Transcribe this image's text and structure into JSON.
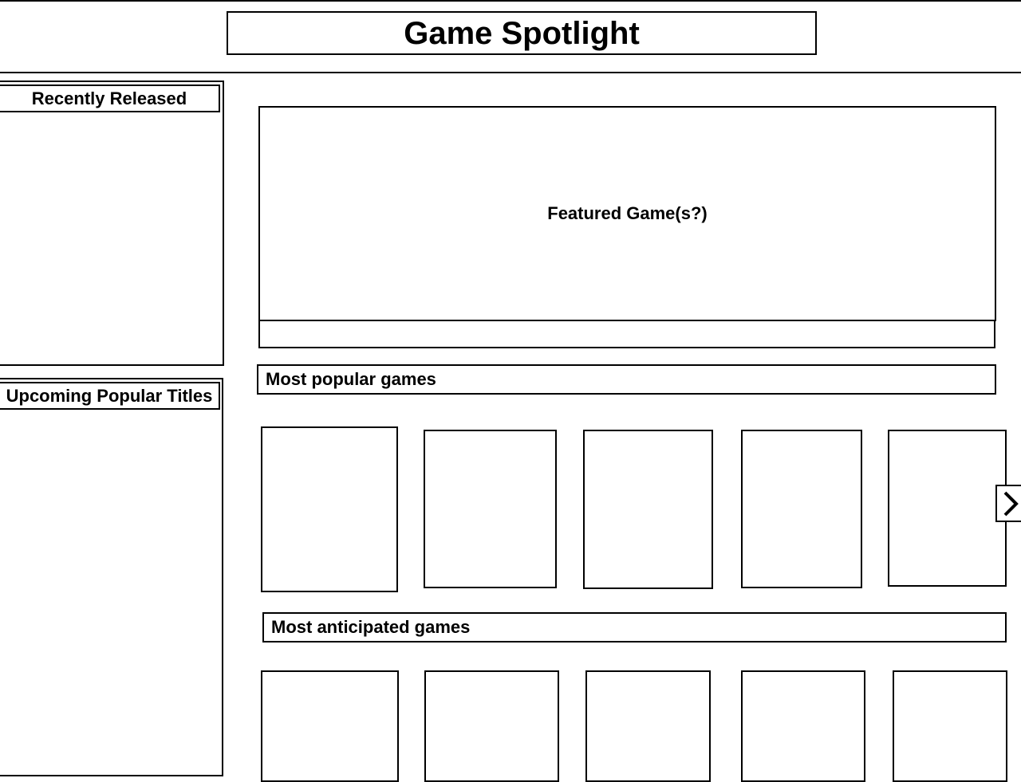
{
  "header": {
    "title": "Game Spotlight"
  },
  "sidebar": {
    "recently_released": {
      "heading": "Recently Released"
    },
    "upcoming_popular": {
      "heading": "Upcoming Popular Titles"
    }
  },
  "featured": {
    "label": "Featured Game(s?)"
  },
  "sections": {
    "most_popular": {
      "heading": "Most popular games"
    },
    "most_anticipated": {
      "heading": "Most anticipated games"
    }
  },
  "icons": {
    "next": "chevron-right-icon"
  }
}
